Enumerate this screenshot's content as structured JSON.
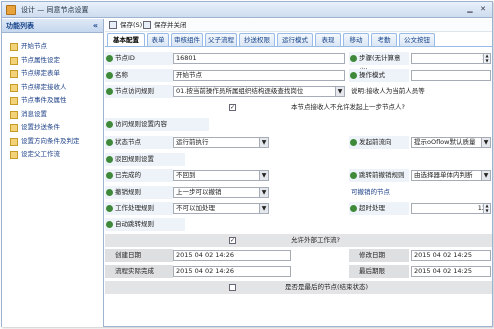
{
  "window": {
    "title": "设计 — 同意节点设置"
  },
  "left": {
    "header": "功能列表",
    "collapse": "«",
    "items": [
      {
        "label": "开始节点"
      },
      {
        "label": "节点属性设定"
      },
      {
        "label": "节点绑定表单"
      },
      {
        "label": "节点绑定接收人"
      },
      {
        "label": "节点事件及属性"
      },
      {
        "label": "消息设置"
      },
      {
        "label": "设置抄送条件"
      },
      {
        "label": "设置方向条件及判定"
      },
      {
        "label": "设定父工作流"
      }
    ]
  },
  "toolbar": {
    "save": "保存(S)",
    "save_close": "保存并关闭"
  },
  "tabs": [
    "基本配置",
    "表单",
    "审核组件",
    "父子流程",
    "抄送权限",
    "运行模式",
    "表现",
    "移动",
    "考勤",
    "公文按钮"
  ],
  "form": {
    "node_id_label": "节点ID",
    "node_id_value": "16801",
    "step_label": "步骤(无计算意义)",
    "step_value": "1",
    "name_label": "名称",
    "name_value": "开始节点",
    "op_label": "操作模式",
    "op_value": "",
    "prev_label": "节点访问规则",
    "prev_value": "01.按当前操作员所属组织结构逐级查找岗位",
    "prev_extra": "说明:接收人为当前人员等",
    "recall_text": "本节点接收人不允许发起上一步节点人?",
    "help_label": "访问规则设置内容",
    "status_label": "状态节点",
    "status_value": "运行前执行",
    "status2_label": "发起前流向",
    "status2_value": "提示oOflow默认质量",
    "reject_label": "驳回规则设置",
    "reject2_label": "已完成的",
    "reject2_value": "不回到",
    "jump_label": "跳转前撤销规则",
    "jump_value": "由选择器单体内判断",
    "cancel_label": "撤销规则",
    "cancel_value": "上一步可以撤销",
    "cancel_extra": "可撤销的节点",
    "work_label": "工作处理规则",
    "work_value": "不可以加处理",
    "timeout_label": "超时处理",
    "timeout_value": "12",
    "auto_label": "自动跳转规则",
    "cc_text": "允许外部工作流?",
    "create_label": "创建日期",
    "create_value": "2015 04 02 14:26",
    "modify_label": "修改日期",
    "modify_value": "2015 04 02 14:25",
    "complete_label": "流程实际完成",
    "complete_value": "2015 04 02 14:26",
    "deadline_label": "最后期限",
    "deadline_value": "2015 04 02 14:25",
    "final_text": "是否是最后的节点(结束状态)"
  }
}
